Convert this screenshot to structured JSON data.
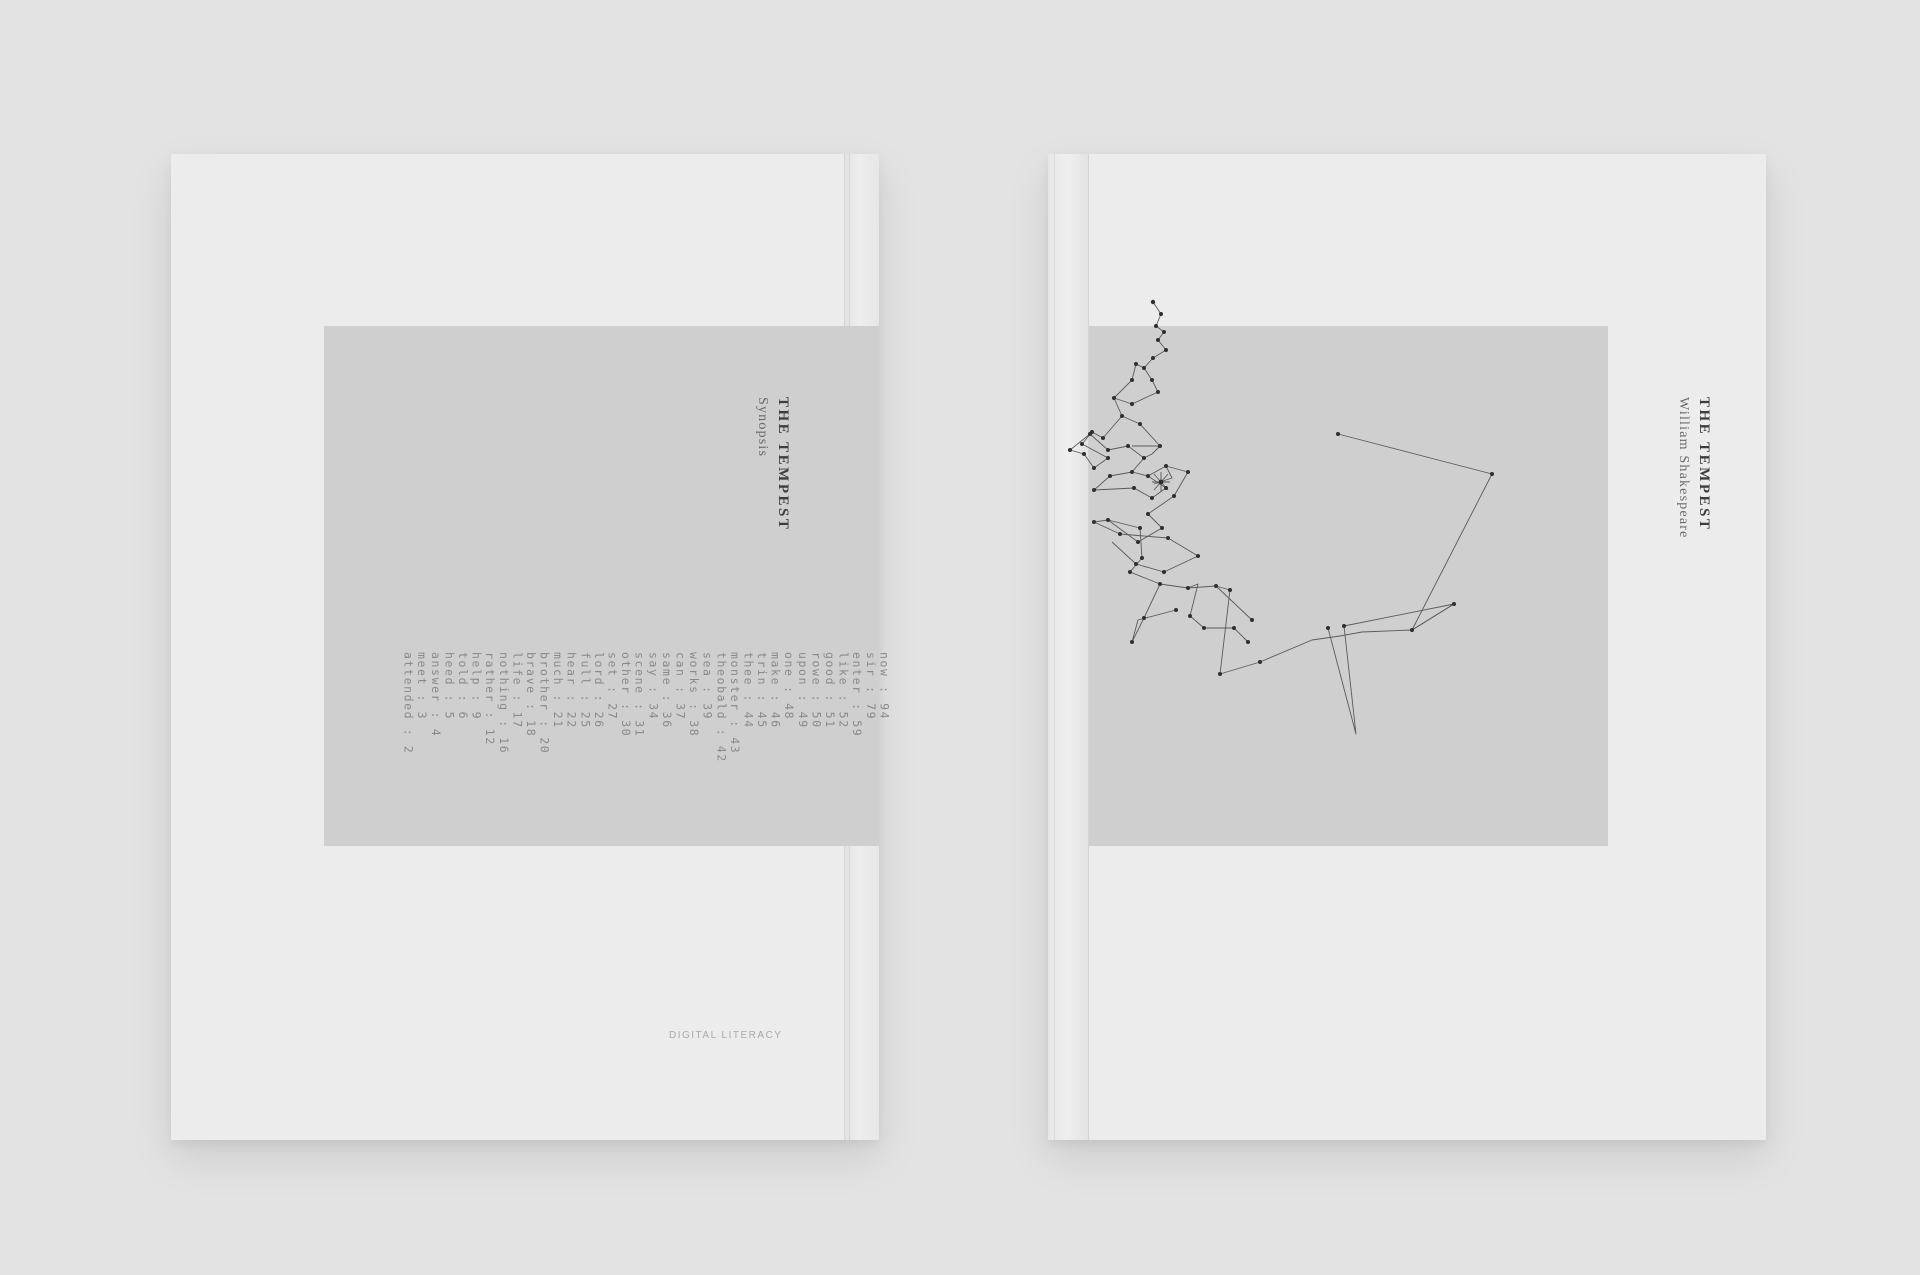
{
  "back_cover": {
    "title": "THE TEMPEST",
    "subtitle": "Synopsis",
    "word_counts": [
      "now : 94",
      "sir : 79",
      "enter : 59",
      "like : 52",
      "good : 51",
      "rowe : 50",
      "upon : 49",
      "one : 48",
      "make : 46",
      "trin : 45",
      "thee : 44",
      "monster : 43",
      "theobald : 42",
      "sea : 39",
      "works : 38",
      "can : 37",
      "same : 36",
      "say : 34",
      "scene : 31",
      "other : 30",
      "set : 27",
      "lord : 26",
      "full : 25",
      "hear : 22",
      "much : 21",
      "brother : 20",
      "brave : 18",
      "life : 17",
      "nothing : 16",
      "rather : 12",
      "help : 9",
      "told : 6",
      "heed : 5",
      "answer : 4",
      "meet : 3",
      "attended : 2"
    ],
    "brand": "DIGITAL LITERACY"
  },
  "front_cover": {
    "title": "THE TEMPEST",
    "author": "William Shakespeare"
  }
}
